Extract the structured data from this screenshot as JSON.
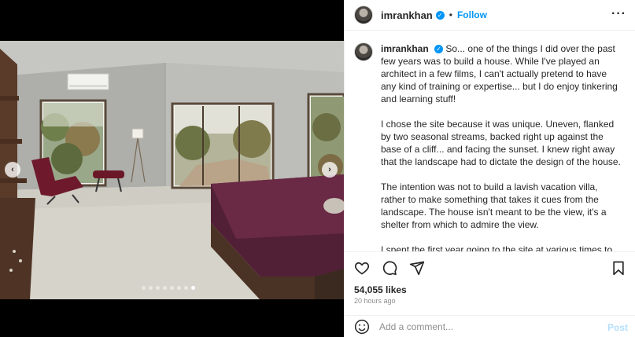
{
  "post": {
    "username": "imrankhan",
    "follow_label": "Follow",
    "separator": "•",
    "more_label": "···",
    "caption_paragraphs": [
      "So... one of the things I did over the past few years was to build a house. While I've played an architect in a few films, I can't actually pretend to have any kind of training or expertise... but I do enjoy tinkering and learning stuff!",
      "I chose the site because it was unique. Uneven, flanked by two seasonal streams, backed right up against the base of a cliff... and facing the sunset. I knew right away that the landscape had to dictate the design of the house.",
      "The intention was not to build a lavish vacation villa, rather to make something that takes it cues from the landscape. The house isn't meant to be the view, it's a shelter from which to admire the view.",
      "I spent the first year going to the site at various times to watch the sunrise and sunset, the flow of the streams when it rains, and the changing foliage through the seasons. This gave me a holistic base from which I could revise and rework my sketches."
    ],
    "likes": "54,055 likes",
    "time_ago": "20 hours ago",
    "comment_placeholder": "Add a comment...",
    "post_label": "Post"
  },
  "carousel": {
    "total_slides": 8,
    "active_index": 7,
    "prev_label": "‹",
    "next_label": "›"
  },
  "icons": {
    "like": "heart-icon",
    "comment": "comment-icon",
    "share": "share-icon",
    "save": "bookmark-icon",
    "emoji": "emoji-icon",
    "verified": "verified-badge-icon"
  },
  "colors": {
    "accent": "#0095f6",
    "post_disabled": "#b2dffc",
    "muted": "#8e8e8e"
  }
}
